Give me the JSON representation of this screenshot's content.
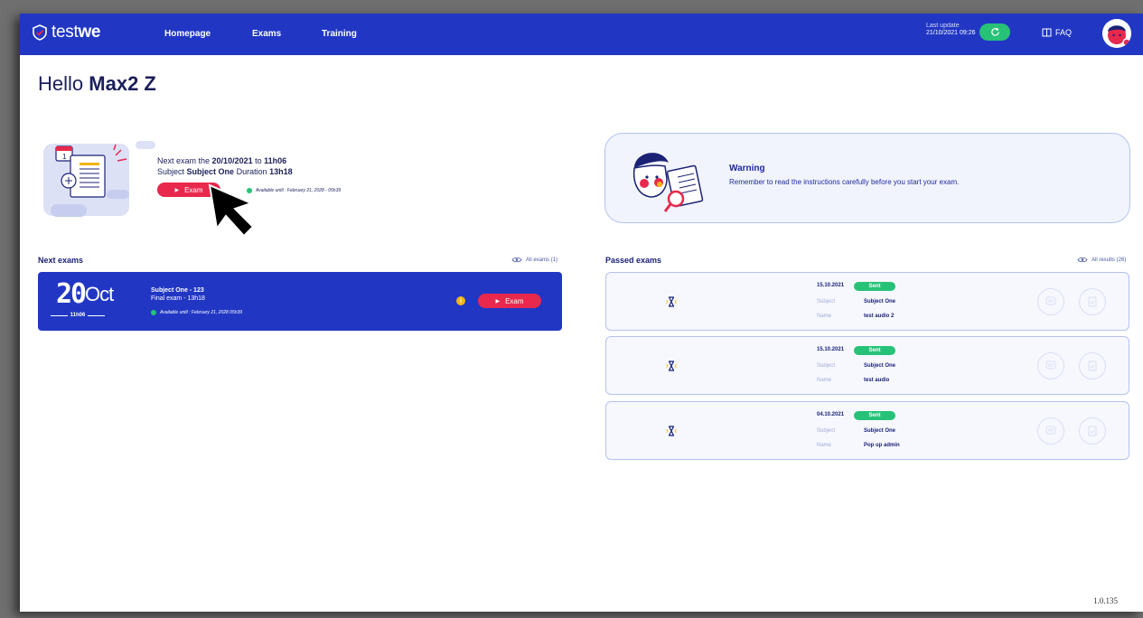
{
  "header": {
    "logo_light": "test",
    "logo_bold": "we",
    "nav": [
      "Homepage",
      "Exams",
      "Training"
    ],
    "last_update_label": "Last update",
    "last_update_value": "21/10/2021 09:26",
    "faq": "FAQ"
  },
  "greeting": {
    "prefix": "Hello",
    "name": "Max2 Z"
  },
  "next_exam_summary": {
    "line1_prefix": "Next exam the",
    "date": "20/10/2021",
    "to": "to",
    "time": "11h06",
    "subject_label": "Subject",
    "subject": "Subject One",
    "duration_label": "Duration",
    "duration": "13h18",
    "button": "Exam",
    "available": "Available until : February 21, 2028 - 05h39"
  },
  "warning": {
    "title": "Warning",
    "text": "Remember to read the instructions carefully before you start your exam."
  },
  "next_exams": {
    "title": "Next exams",
    "link": "All exams (1)",
    "cards": [
      {
        "day": "20",
        "month": "Oct",
        "time": "11h06",
        "subject": "Subject One - 123",
        "final": "Final exam - 13h18",
        "available": "Available until : February 21, 2028 05h39",
        "button": "Exam",
        "info": "i"
      }
    ]
  },
  "passed_exams": {
    "title": "Passed exams",
    "link": "All results (26)",
    "subject_label": "Subject",
    "name_label": "Name",
    "items": [
      {
        "date": "15.10.2021",
        "status": "Sent",
        "subject": "Subject One",
        "name": "test audio 2"
      },
      {
        "date": "15.10.2021",
        "status": "Sent",
        "subject": "Subject One",
        "name": "test audio"
      },
      {
        "date": "04.10.2021",
        "status": "Sent",
        "subject": "Subject One",
        "name": "Pop up admin"
      }
    ]
  },
  "version": "1.0.135",
  "colors": {
    "primary": "#2137c4",
    "accent_red": "#e8284c",
    "success": "#27c277",
    "text_dark": "#1b1f5a"
  }
}
